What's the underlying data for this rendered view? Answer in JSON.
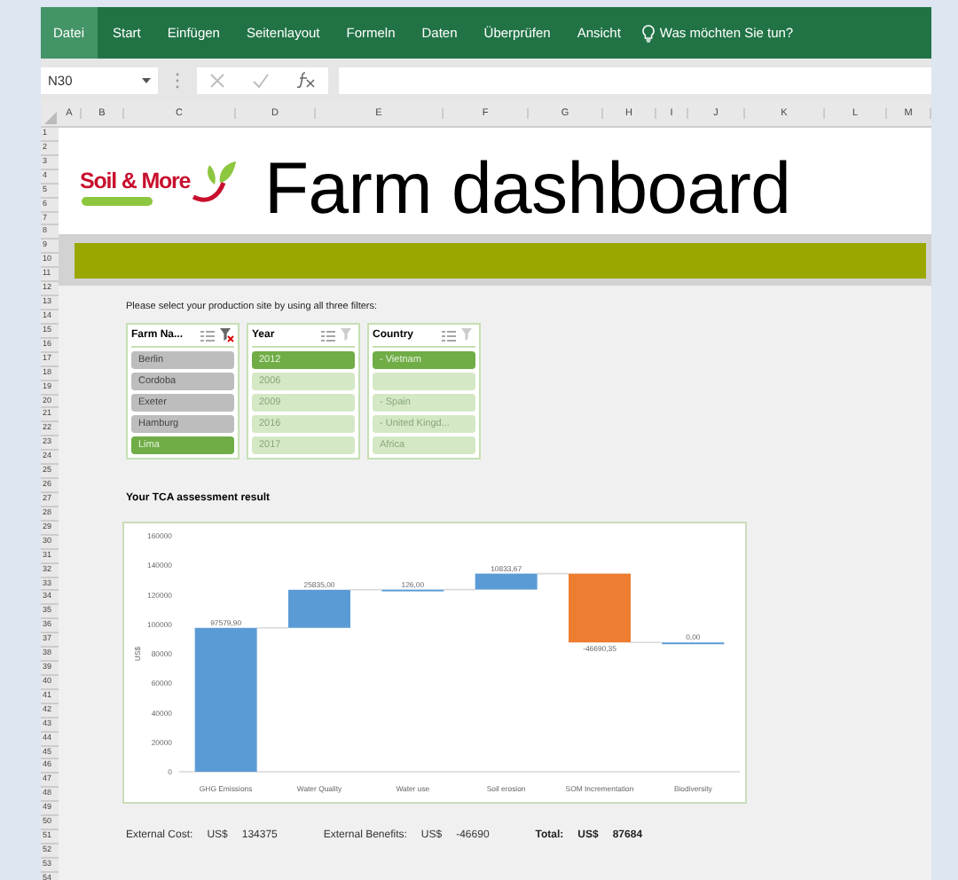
{
  "ribbon": {
    "tabs": [
      {
        "label": "Datei",
        "selected": true
      },
      {
        "label": "Start",
        "selected": false
      },
      {
        "label": "Einfügen",
        "selected": false
      },
      {
        "label": "Seitenlayout",
        "selected": false
      },
      {
        "label": "Formeln",
        "selected": false
      },
      {
        "label": "Daten",
        "selected": false
      },
      {
        "label": "Überprüfen",
        "selected": false
      },
      {
        "label": "Ansicht",
        "selected": false
      }
    ],
    "tell_me": "Was möchten Sie tun?"
  },
  "formula_bar": {
    "name_box": "N30"
  },
  "columns": [
    "A",
    "B",
    "C",
    "D",
    "E",
    "F",
    "G",
    "H",
    "I",
    "J",
    "K",
    "L",
    "M"
  ],
  "rows": [
    "1",
    "2",
    "3",
    "4",
    "5",
    "6",
    "7",
    "8",
    "9",
    "10",
    "11",
    "12",
    "13",
    "14",
    "15",
    "16",
    "17",
    "18",
    "19",
    "20",
    "21",
    "22",
    "23",
    "24",
    "25",
    "26",
    "27",
    "28",
    "29",
    "30",
    "31",
    "32",
    "33",
    "34",
    "35",
    "36",
    "37",
    "38",
    "39",
    "40",
    "41",
    "42",
    "43",
    "44",
    "45",
    "46",
    "47",
    "48",
    "49",
    "50",
    "51",
    "52",
    "53",
    "54"
  ],
  "header": {
    "logo": "Soil & More",
    "title": "Farm dashboard"
  },
  "instruction": "Please select your production site by using all three filters:",
  "slicers": [
    {
      "title": "Farm Na...",
      "clear_enabled": true,
      "items": [
        {
          "label": "Berlin",
          "selected": false,
          "available": false
        },
        {
          "label": "Cordoba",
          "selected": false,
          "available": false
        },
        {
          "label": "Exeter",
          "selected": false,
          "available": false
        },
        {
          "label": "Hamburg",
          "selected": false,
          "available": false
        },
        {
          "label": "Lima",
          "selected": true,
          "available": true
        }
      ]
    },
    {
      "title": "Year",
      "clear_enabled": false,
      "items": [
        {
          "label": "2012",
          "selected": true,
          "available": true
        },
        {
          "label": "2006",
          "selected": false,
          "available": true
        },
        {
          "label": "2009",
          "selected": false,
          "available": true
        },
        {
          "label": "2016",
          "selected": false,
          "available": true
        },
        {
          "label": "2017",
          "selected": false,
          "available": true
        }
      ]
    },
    {
      "title": "Country",
      "clear_enabled": false,
      "items": [
        {
          "label": "- Vietnam",
          "selected": true,
          "available": true
        },
        {
          "selected": false,
          "available": true
        },
        {
          "label": "- Spain",
          "selected": false,
          "available": true
        },
        {
          "label": "- United Kingd...",
          "selected": false,
          "available": true
        },
        {
          "label": "Africa",
          "selected": false,
          "available": true
        }
      ]
    }
  ],
  "result_heading": "Your TCA assessment result",
  "chart": {
    "kind": "waterfall",
    "y_axis_title": "US$",
    "y_ticks": [
      "160000",
      "140000",
      "120000",
      "100000",
      "80000",
      "60000",
      "40000",
      "20000",
      "0"
    ],
    "categories": [
      "GHG Emissions",
      "Water Quality",
      "Water use",
      "Soil erosion",
      "SOM Incrementation",
      "Biodiversity"
    ],
    "value_labels": [
      "97579,90",
      "25835,00",
      "126,00",
      "10833,67",
      "-46690,35",
      "0,00"
    ]
  },
  "summary": [
    {
      "label": "External Cost:",
      "currency": "US$",
      "value": "134375",
      "bold": false
    },
    {
      "label": "External Benefits:",
      "currency": "US$",
      "value": "-46690",
      "bold": false
    },
    {
      "label": "Total:",
      "currency": "US$",
      "value": "87684",
      "bold": true
    }
  ]
}
